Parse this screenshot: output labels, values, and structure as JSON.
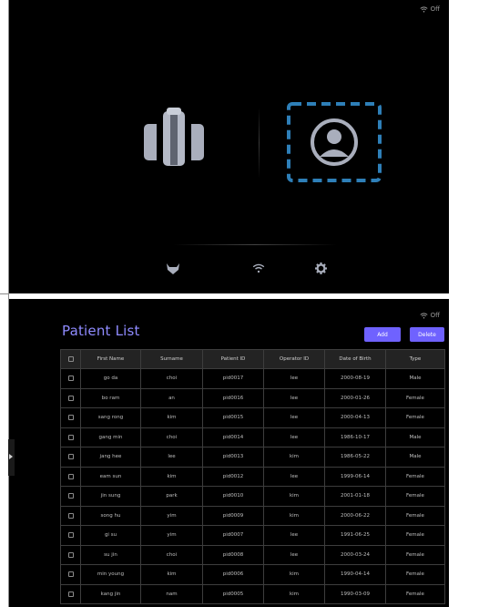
{
  "colors": {
    "accent": "#6f62ff",
    "title": "#8f8bff",
    "selected_outline": "#2e7fb8"
  },
  "top_screen": {
    "wifi_status": "Off",
    "options": [
      {
        "name": "probe",
        "icon": "probe-icon"
      },
      {
        "name": "patient",
        "icon": "user-avatar-icon",
        "selected": true
      }
    ],
    "bottom_icons": [
      "preset-icon",
      "wifi-icon",
      "gear-icon"
    ]
  },
  "patient_list": {
    "wifi_status": "Off",
    "title": "Patient List",
    "add_label": "Add",
    "delete_label": "Delete",
    "columns": [
      "First Name",
      "Surname",
      "Patient ID",
      "Operator ID",
      "Date of Birth",
      "Type"
    ],
    "rows": [
      [
        "go da",
        "choi",
        "pid0017",
        "lee",
        "2000-08-19",
        "Male"
      ],
      [
        "bo ram",
        "an",
        "pid0016",
        "lee",
        "2000-01-26",
        "Female"
      ],
      [
        "sang rong",
        "kim",
        "pid0015",
        "lee",
        "2000-04-13",
        "Female"
      ],
      [
        "gang min",
        "choi",
        "pid0014",
        "lee",
        "1986-10-17",
        "Male"
      ],
      [
        "jang hee",
        "lee",
        "pid0013",
        "kim",
        "1986-05-22",
        "Male"
      ],
      [
        "eam sun",
        "kim",
        "pid0012",
        "lee",
        "1999-06-14",
        "Female"
      ],
      [
        "jin sung",
        "park",
        "pid0010",
        "kim",
        "2001-01-18",
        "Female"
      ],
      [
        "song hu",
        "yim",
        "pid0009",
        "kim",
        "2000-06-22",
        "Female"
      ],
      [
        "gi su",
        "yim",
        "pid0007",
        "lee",
        "1991-06-25",
        "Female"
      ],
      [
        "su jin",
        "choi",
        "pid0008",
        "lee",
        "2000-03-24",
        "Female"
      ],
      [
        "min young",
        "kim",
        "pid0006",
        "kim",
        "1990-04-14",
        "Female"
      ],
      [
        "kang jin",
        "nam",
        "pid0005",
        "kim",
        "1990-03-09",
        "Female"
      ]
    ]
  }
}
